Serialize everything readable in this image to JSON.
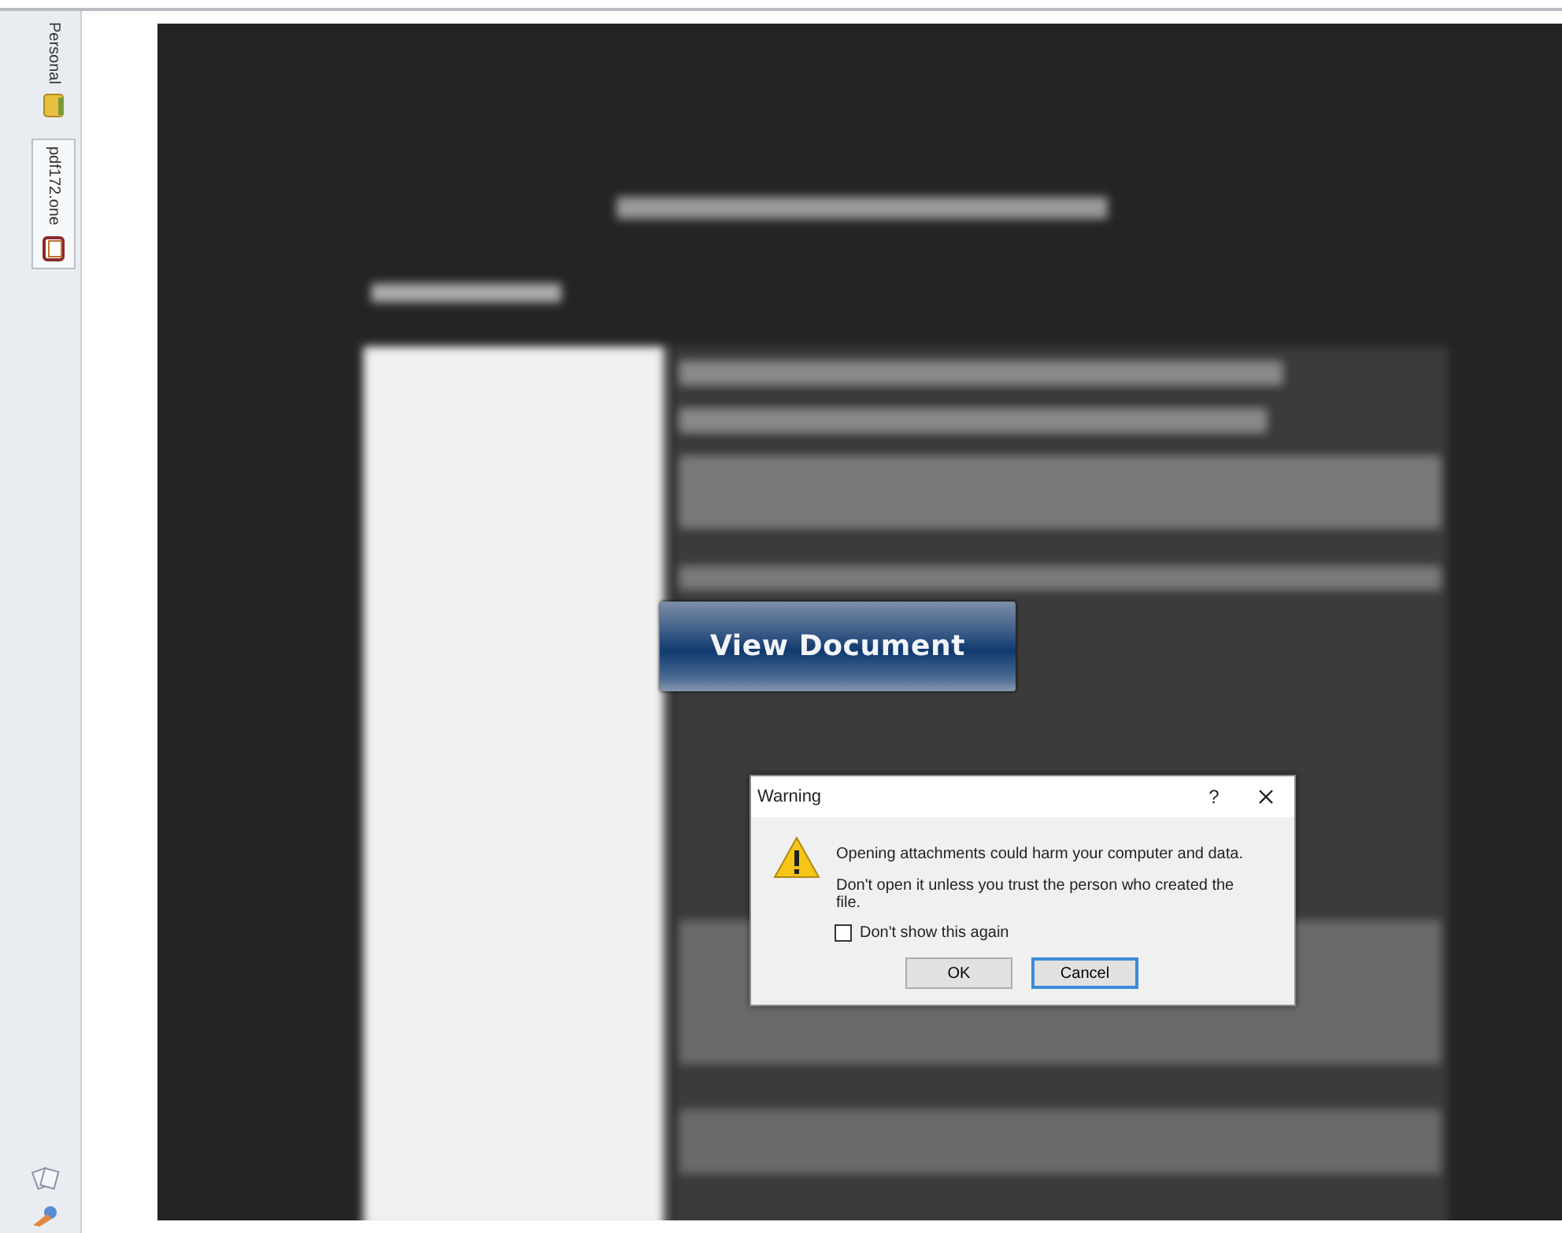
{
  "sidebar": {
    "notebooks": [
      {
        "label": "Personal",
        "selected": false
      },
      {
        "label": "pdf172.one",
        "selected": true
      }
    ]
  },
  "overlay_button": {
    "label": "View Document"
  },
  "dialog": {
    "title": "Warning",
    "help": "?",
    "message": "Opening attachments could harm your computer and data.",
    "detail": "Don't open it unless you trust the person who created the file.",
    "checkbox": {
      "label": "Don't show this again",
      "checked": false
    },
    "buttons": [
      {
        "label": "OK",
        "focused": false
      },
      {
        "label": "Cancel",
        "focused": true
      }
    ]
  }
}
